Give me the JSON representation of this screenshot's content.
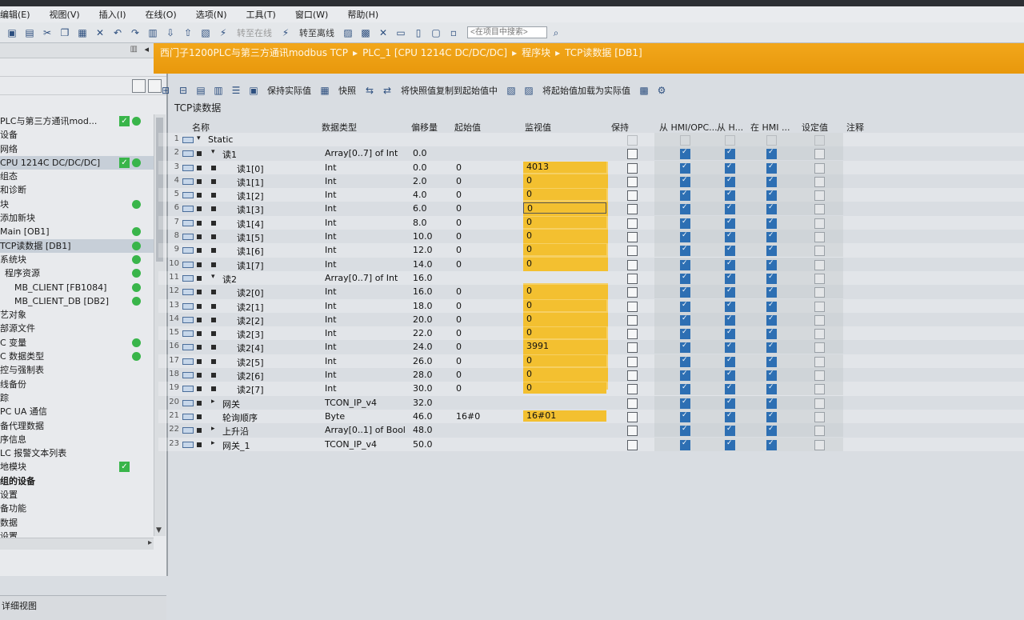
{
  "menu": [
    "编辑(E)",
    "视图(V)",
    "插入(I)",
    "在线(O)",
    "选项(N)",
    "工具(T)",
    "窗口(W)",
    "帮助(H)"
  ],
  "toolbar": {
    "go_online": "转至在线",
    "go_offline": "转至离线",
    "search_placeholder": "<在项目中搜索>"
  },
  "breadcrumb": {
    "items": [
      "西门子1200PLC与第三方通讯modbus TCP",
      "PLC_1 [CPU 1214C DC/DC/DC]",
      "程序块",
      "TCP读数据 [DB1]"
    ]
  },
  "block_toolbar": {
    "keep_actual": "保持实际值",
    "snapshot": "快照",
    "copy_to_start": "将快照值复制到起始值中",
    "load_start_as_actual": "将起始值加载为实际值"
  },
  "block_title": "TCP读数据",
  "columns": [
    "名称",
    "数据类型",
    "偏移量",
    "起始值",
    "监视值",
    "保持",
    "从 HMI/OPC...",
    "从 H...",
    "在 HMI ...",
    "设定值",
    "注释"
  ],
  "tree": [
    {
      "label": "PLC与第三方通讯mod...",
      "check": true,
      "status": true
    },
    {
      "label": "设备"
    },
    {
      "label": "网络"
    },
    {
      "label": "CPU 1214C DC/DC/DC]",
      "check": true,
      "status": true,
      "sel": true
    },
    {
      "label": "组态"
    },
    {
      "label": "和诊断"
    },
    {
      "label": "块",
      "status": true
    },
    {
      "label": "添加新块"
    },
    {
      "label": "Main [OB1]",
      "status": true
    },
    {
      "label": "TCP读数据 [DB1]",
      "status": true,
      "sel": true
    },
    {
      "label": "系统块",
      "status": true
    },
    {
      "label": "程序资源",
      "status": true
    },
    {
      "label": "MB_CLIENT [FB1084]",
      "status": true
    },
    {
      "label": "MB_CLIENT_DB [DB2]",
      "status": true
    },
    {
      "label": "艺对象"
    },
    {
      "label": "部源文件"
    },
    {
      "label": "C 变量",
      "status": true
    },
    {
      "label": "C 数据类型",
      "status": true
    },
    {
      "label": "控与强制表"
    },
    {
      "label": "线备份"
    },
    {
      "label": "踪"
    },
    {
      "label": "PC UA 通信"
    },
    {
      "label": "备代理数据"
    },
    {
      "label": "序信息"
    },
    {
      "label": "LC 报警文本列表"
    },
    {
      "label": "地模块",
      "check": true
    },
    {
      "label": "组的设备",
      "bold": true
    },
    {
      "label": "设置"
    },
    {
      "label": "备功能"
    },
    {
      "label": "数据"
    },
    {
      "label": "设置"
    }
  ],
  "left_bottom": "详细视图",
  "rows": [
    {
      "n": "1",
      "lvl": 0,
      "tri": "▾",
      "name": "Static",
      "type": "",
      "off": "",
      "start": "",
      "mon": "",
      "flags": "none"
    },
    {
      "n": "2",
      "lvl": 1,
      "tri": "▾",
      "name": "读1",
      "type": "Array[0..7] of Int",
      "off": "0.0",
      "start": "",
      "mon": "",
      "flags": "arr"
    },
    {
      "n": "3",
      "lvl": 2,
      "tri": "",
      "name": "读1[0]",
      "type": "Int",
      "off": "0.0",
      "start": "0",
      "mon": "4013",
      "flags": "el"
    },
    {
      "n": "4",
      "lvl": 2,
      "tri": "",
      "name": "读1[1]",
      "type": "Int",
      "off": "2.0",
      "start": "0",
      "mon": "0",
      "flags": "el"
    },
    {
      "n": "5",
      "lvl": 2,
      "tri": "",
      "name": "读1[2]",
      "type": "Int",
      "off": "4.0",
      "start": "0",
      "mon": "0",
      "flags": "el"
    },
    {
      "n": "6",
      "lvl": 2,
      "tri": "",
      "name": "读1[3]",
      "type": "Int",
      "off": "6.0",
      "start": "0",
      "mon": "0",
      "flags": "el",
      "sel": true
    },
    {
      "n": "7",
      "lvl": 2,
      "tri": "",
      "name": "读1[4]",
      "type": "Int",
      "off": "8.0",
      "start": "0",
      "mon": "0",
      "flags": "el"
    },
    {
      "n": "8",
      "lvl": 2,
      "tri": "",
      "name": "读1[5]",
      "type": "Int",
      "off": "10.0",
      "start": "0",
      "mon": "0",
      "flags": "el"
    },
    {
      "n": "9",
      "lvl": 2,
      "tri": "",
      "name": "读1[6]",
      "type": "Int",
      "off": "12.0",
      "start": "0",
      "mon": "0",
      "flags": "el"
    },
    {
      "n": "10",
      "lvl": 2,
      "tri": "",
      "name": "读1[7]",
      "type": "Int",
      "off": "14.0",
      "start": "0",
      "mon": "0",
      "flags": "el"
    },
    {
      "n": "11",
      "lvl": 1,
      "tri": "▾",
      "name": "读2",
      "type": "Array[0..7] of Int",
      "off": "16.0",
      "start": "",
      "mon": "",
      "flags": "arr"
    },
    {
      "n": "12",
      "lvl": 2,
      "tri": "",
      "name": "读2[0]",
      "type": "Int",
      "off": "16.0",
      "start": "0",
      "mon": "0",
      "flags": "el"
    },
    {
      "n": "13",
      "lvl": 2,
      "tri": "",
      "name": "读2[1]",
      "type": "Int",
      "off": "18.0",
      "start": "0",
      "mon": "0",
      "flags": "el"
    },
    {
      "n": "14",
      "lvl": 2,
      "tri": "",
      "name": "读2[2]",
      "type": "Int",
      "off": "20.0",
      "start": "0",
      "mon": "0",
      "flags": "el"
    },
    {
      "n": "15",
      "lvl": 2,
      "tri": "",
      "name": "读2[3]",
      "type": "Int",
      "off": "22.0",
      "start": "0",
      "mon": "0",
      "flags": "el"
    },
    {
      "n": "16",
      "lvl": 2,
      "tri": "",
      "name": "读2[4]",
      "type": "Int",
      "off": "24.0",
      "start": "0",
      "mon": "3991",
      "flags": "el"
    },
    {
      "n": "17",
      "lvl": 2,
      "tri": "",
      "name": "读2[5]",
      "type": "Int",
      "off": "26.0",
      "start": "0",
      "mon": "0",
      "flags": "el"
    },
    {
      "n": "18",
      "lvl": 2,
      "tri": "",
      "name": "读2[6]",
      "type": "Int",
      "off": "28.0",
      "start": "0",
      "mon": "0",
      "flags": "el"
    },
    {
      "n": "19",
      "lvl": 2,
      "tri": "",
      "name": "读2[7]",
      "type": "Int",
      "off": "30.0",
      "start": "0",
      "mon": "0",
      "flags": "el"
    },
    {
      "n": "20",
      "lvl": 1,
      "tri": "▸",
      "name": "网关",
      "type": "TCON_IP_v4",
      "off": "32.0",
      "start": "",
      "mon": "",
      "flags": "arr"
    },
    {
      "n": "21",
      "lvl": 1,
      "tri": "",
      "name": "轮询顺序",
      "type": "Byte",
      "off": "46.0",
      "start": "16#0",
      "mon": "16#01",
      "flags": "arr"
    },
    {
      "n": "22",
      "lvl": 1,
      "tri": "▸",
      "name": "上升沿",
      "type": "Array[0..1] of Bool",
      "off": "48.0",
      "start": "",
      "mon": "",
      "flags": "arr"
    },
    {
      "n": "23",
      "lvl": 1,
      "tri": "▸",
      "name": "网关_1",
      "type": "TCON_IP_v4",
      "off": "50.0",
      "start": "",
      "mon": "",
      "flags": "arr"
    }
  ],
  "colors": {
    "accent": "#f3c030",
    "breadcrumb": "#f2a71b",
    "check": "#2d6fb3",
    "status": "#39b54a"
  }
}
